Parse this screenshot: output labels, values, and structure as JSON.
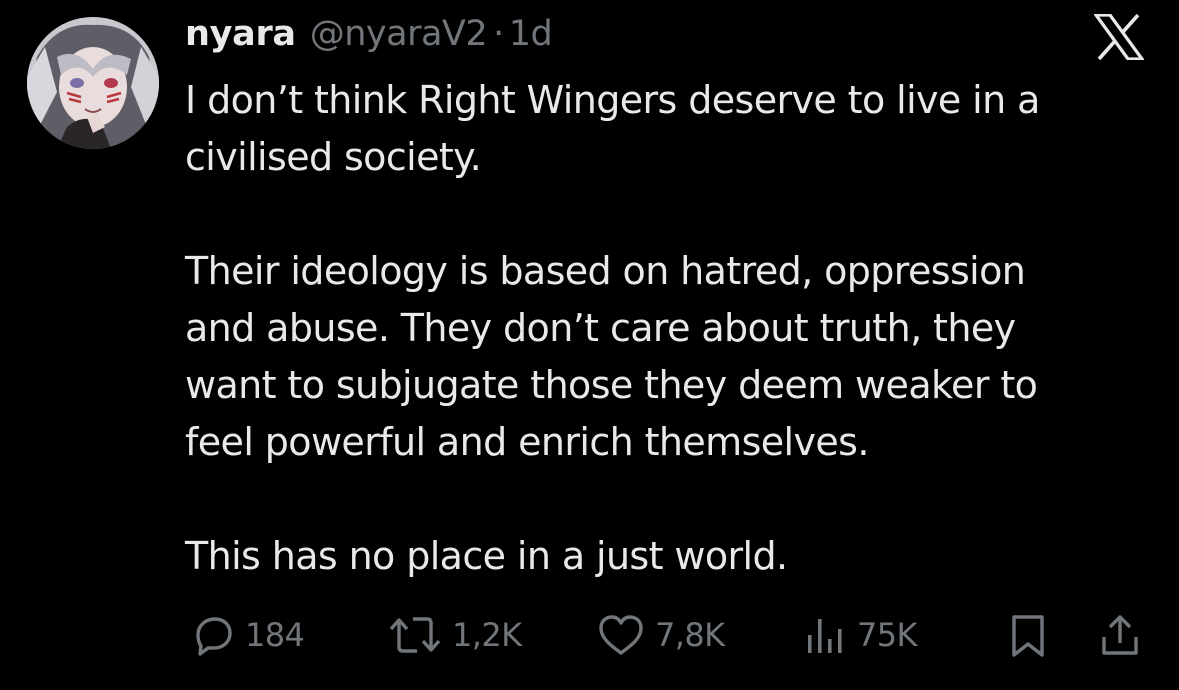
{
  "author": {
    "display_name": "nyara",
    "handle": "@nyaraV2",
    "separator": "·",
    "time": "1d"
  },
  "platform_logo": "x-logo",
  "tweet": {
    "paragraphs": [
      "I don’t think Right Wingers deserve to live in a\ncivilised society.",
      "Their ideology is based on hatred, oppression\nand abuse. They don’t care about truth, they\nwant to subjugate those they deem weaker to\nfeel powerful and enrich themselves.",
      "This has no place in a just world."
    ]
  },
  "actions": {
    "replies": {
      "icon": "reply-icon",
      "count": "184"
    },
    "reposts": {
      "icon": "repost-icon",
      "count": "1,2K"
    },
    "likes": {
      "icon": "heart-icon",
      "count": "7,8K"
    },
    "views": {
      "icon": "views-icon",
      "count": "75K"
    },
    "bookmark": {
      "icon": "bookmark-icon"
    },
    "share": {
      "icon": "share-icon"
    }
  },
  "colors": {
    "background": "#000000",
    "text_primary": "#e7e9ea",
    "text_secondary": "#71767b"
  }
}
